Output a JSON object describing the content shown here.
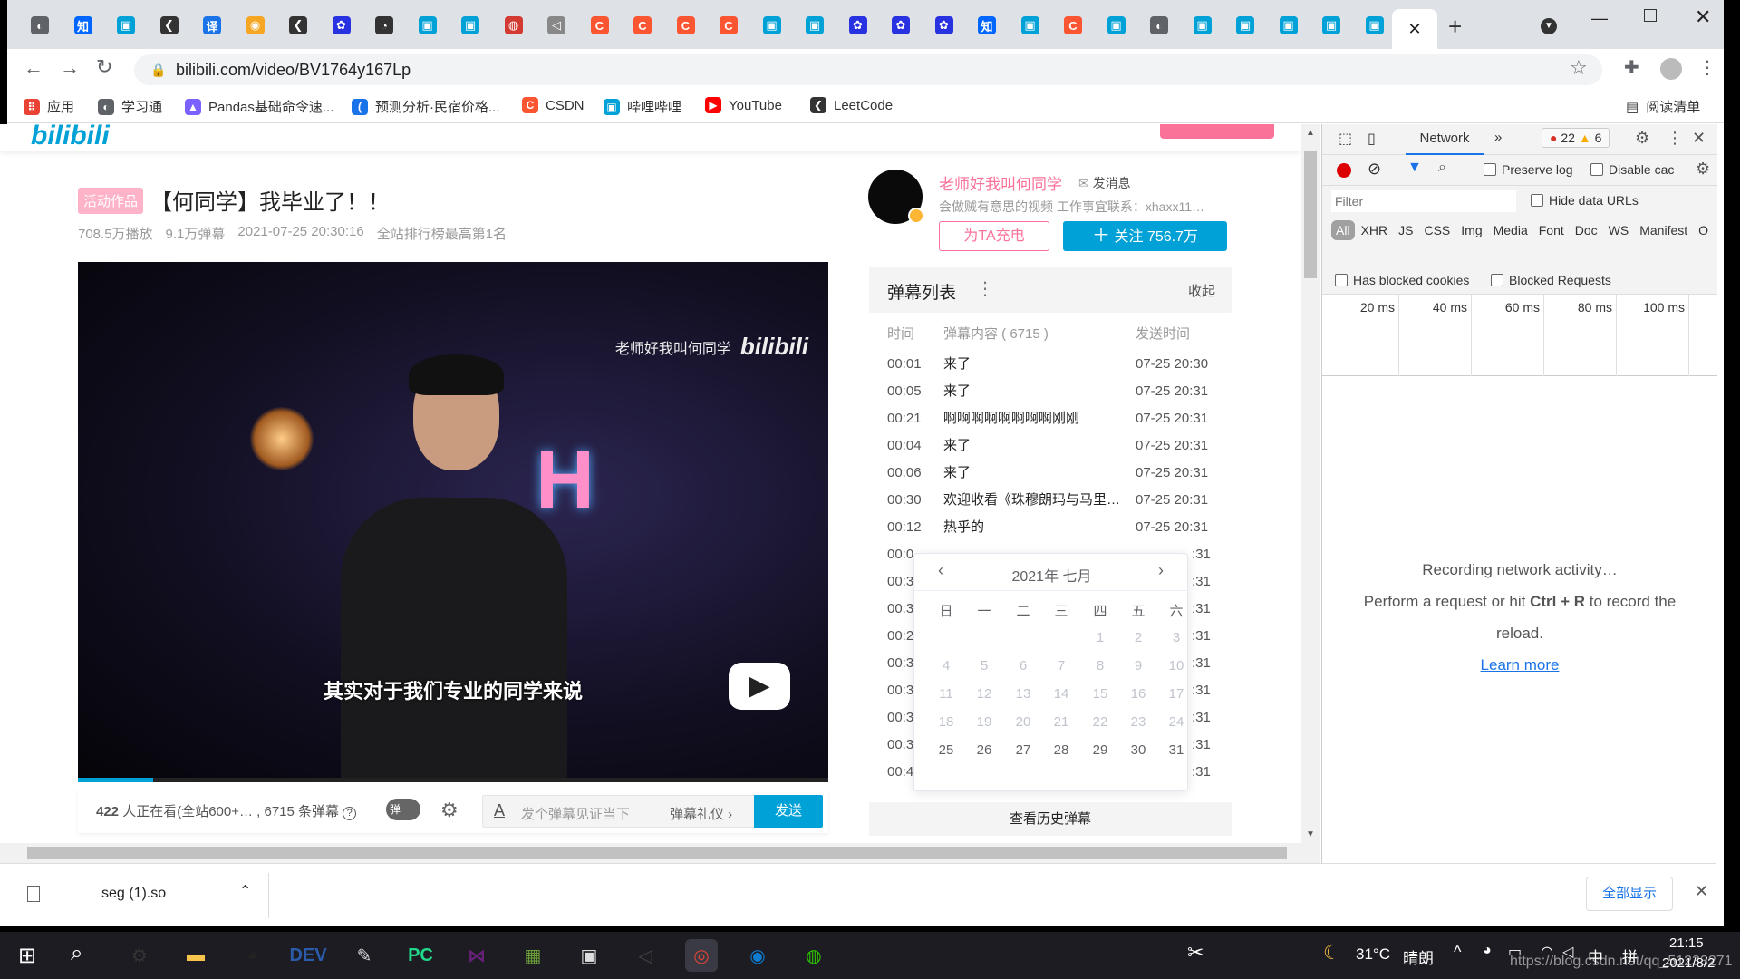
{
  "browser": {
    "tabs": [
      {
        "icon": "globe",
        "color": "#5f6368",
        "g": "◐"
      },
      {
        "icon": "zhihu",
        "color": "#0066ff",
        "g": "知"
      },
      {
        "icon": "bilibili",
        "color": "#00a1d6",
        "g": "▣"
      },
      {
        "icon": "leetcode",
        "color": "#333",
        "g": "❮"
      },
      {
        "icon": "translate",
        "color": "#1a73e8",
        "g": "译"
      },
      {
        "icon": "firefox-like",
        "color": "#f5a623",
        "g": "◉"
      },
      {
        "icon": "leetcode",
        "color": "#333",
        "g": "❮"
      },
      {
        "icon": "baidu",
        "color": "#2932e1",
        "g": "✿"
      },
      {
        "icon": "github-like",
        "color": "#333",
        "g": "◔"
      },
      {
        "icon": "bilibili",
        "color": "#00a1d6",
        "g": "▣"
      },
      {
        "icon": "bilibili",
        "color": "#00a1d6",
        "g": "▣"
      },
      {
        "icon": "netease",
        "color": "#d33a31",
        "g": "◍"
      },
      {
        "icon": "send",
        "color": "#888",
        "g": "◁"
      },
      {
        "icon": "csdn",
        "color": "#fc5531",
        "g": "C"
      },
      {
        "icon": "csdn",
        "color": "#fc5531",
        "g": "C"
      },
      {
        "icon": "csdn",
        "color": "#fc5531",
        "g": "C"
      },
      {
        "icon": "csdn",
        "color": "#fc5531",
        "g": "C"
      },
      {
        "icon": "bilibili",
        "color": "#00a1d6",
        "g": "▣"
      },
      {
        "icon": "bilibili",
        "color": "#00a1d6",
        "g": "▣"
      },
      {
        "icon": "baidu",
        "color": "#2932e1",
        "g": "✿"
      },
      {
        "icon": "baidu",
        "color": "#2932e1",
        "g": "✿"
      },
      {
        "icon": "baidu",
        "color": "#2932e1",
        "g": "✿"
      },
      {
        "icon": "zhihu",
        "color": "#0066ff",
        "g": "知"
      },
      {
        "icon": "bilibili",
        "color": "#00a1d6",
        "g": "▣"
      },
      {
        "icon": "csdn",
        "color": "#fc5531",
        "g": "C"
      },
      {
        "icon": "bilibili",
        "color": "#00a1d6",
        "g": "▣"
      },
      {
        "icon": "globe",
        "color": "#5f6368",
        "g": "◐"
      },
      {
        "icon": "bilibili",
        "color": "#00a1d6",
        "g": "▣"
      },
      {
        "icon": "bilibili",
        "color": "#00a1d6",
        "g": "▣"
      },
      {
        "icon": "bilibili",
        "color": "#00a1d6",
        "g": "▣"
      },
      {
        "icon": "bilibili",
        "color": "#00a1d6",
        "g": "▣"
      },
      {
        "icon": "bilibili",
        "color": "#00a1d6",
        "g": "▣"
      }
    ],
    "url": "bilibili.com/video/BV1764y167Lp",
    "bookmarks": [
      {
        "label": "应用",
        "color": "#ea4335",
        "g": "⠿"
      },
      {
        "label": "学习通",
        "color": "#5f6368",
        "g": "◐"
      },
      {
        "label": "Pandas基础命令速...",
        "color": "#7b61ff",
        "g": "▲"
      },
      {
        "label": "预测分析·民宿价格...",
        "color": "#1a73e8",
        "g": "("
      },
      {
        "label": "CSDN",
        "color": "#fc5531",
        "g": "C"
      },
      {
        "label": "哔哩哔哩",
        "color": "#00a1d6",
        "g": "▣"
      },
      {
        "label": "YouTube",
        "color": "#ff0000",
        "g": "▶"
      },
      {
        "label": "LeetCode",
        "color": "#333",
        "g": "❮"
      }
    ],
    "reading_list": "阅读清单"
  },
  "video": {
    "tag": "活动作品",
    "title": "【何同学】我毕业了！！",
    "views": "708.5万播放",
    "danmaku_count": "9.1万弹幕",
    "date": "2021-07-25 20:30:16",
    "rank": "全站排行榜最高第1名",
    "watermark": "老师好我叫何同学",
    "subtitle": "其实对于我们专业的同学来说",
    "progress_percent": 10,
    "viewers": "422",
    "viewers_text": "人正在看(全站600+… , 6715 条弹幕",
    "danmaku_toggle": "弹",
    "input_placeholder": "发个弹幕见证当下",
    "etiquette": "弹幕礼仪 ›",
    "send": "发送"
  },
  "uploader": {
    "name": "老师好我叫何同学",
    "message": "发消息",
    "desc": "会做贼有意思的视频 工作事宜联系：xhaxx11…",
    "charge": "为TA充电",
    "follow": "关注 756.7万"
  },
  "danmaku": {
    "title": "弹幕列表",
    "collapse": "收起",
    "headers": [
      "时间",
      "弹幕内容 ( 6715 )",
      "发送时间"
    ],
    "rows": [
      [
        "00:01",
        "来了",
        "07-25 20:30"
      ],
      [
        "00:05",
        "来了",
        "07-25 20:31"
      ],
      [
        "00:21",
        "啊啊啊啊啊啊啊啊刚刚",
        "07-25 20:31"
      ],
      [
        "00:04",
        "来了",
        "07-25 20:31"
      ],
      [
        "00:06",
        "来了",
        "07-25 20:31"
      ],
      [
        "00:30",
        "欢迎收看《珠穆朗玛与马里…",
        "07-25 20:31"
      ],
      [
        "00:12",
        "热乎的",
        "07-25 20:31"
      ]
    ],
    "hidden_rows": [
      [
        "00:0",
        ":31"
      ],
      [
        "00:3",
        ":31"
      ],
      [
        "00:3",
        ":31"
      ],
      [
        "00:2",
        ":31"
      ],
      [
        "00:3",
        ":31"
      ],
      [
        "00:3",
        ":31"
      ],
      [
        "00:3",
        ":31"
      ],
      [
        "00:3",
        ":31"
      ],
      [
        "00:4",
        ":31"
      ]
    ],
    "history": "查看历史弹幕"
  },
  "calendar": {
    "title": "2021年 七月",
    "weekdays": [
      "日",
      "一",
      "二",
      "三",
      "四",
      "五",
      "六"
    ],
    "weeks": [
      [
        "",
        "",
        "",
        "",
        "1",
        "2",
        "3"
      ],
      [
        "4",
        "5",
        "6",
        "7",
        "8",
        "9",
        "10"
      ],
      [
        "11",
        "12",
        "13",
        "14",
        "15",
        "16",
        "17"
      ],
      [
        "18",
        "19",
        "20",
        "21",
        "22",
        "23",
        "24"
      ],
      [
        "25",
        "26",
        "27",
        "28",
        "29",
        "30",
        "31"
      ]
    ],
    "enabled_from": 25
  },
  "devtools": {
    "tab": "Network",
    "errors": "22",
    "warnings": "6",
    "preserve_log": "Preserve log",
    "disable_cache": "Disable cac",
    "filter_placeholder": "Filter",
    "hide_data_urls": "Hide data URLs",
    "types": [
      "All",
      "XHR",
      "JS",
      "CSS",
      "Img",
      "Media",
      "Font",
      "Doc",
      "WS",
      "Manifest",
      "O"
    ],
    "has_blocked_cookies": "Has blocked cookies",
    "blocked_requests": "Blocked Requests",
    "timeline": [
      "20 ms",
      "40 ms",
      "60 ms",
      "80 ms",
      "100 ms"
    ],
    "recording": "Recording network activity…",
    "perform_pre": "Perform a request or hit ",
    "shortcut": "Ctrl + R",
    "perform_post": " to record the",
    "reload": "reload.",
    "learn_more": "Learn more"
  },
  "download": {
    "file": "seg (1).so",
    "show_all": "全部显示"
  },
  "taskbar": {
    "apps": [
      {
        "name": "settings",
        "color": "#333",
        "g": "⚙"
      },
      {
        "name": "explorer",
        "color": "#f8c44c",
        "g": "▬"
      },
      {
        "name": "qq",
        "color": "#222",
        "g": "◕"
      },
      {
        "name": "devcpp",
        "color": "#2a5caa",
        "g": "DEV"
      },
      {
        "name": "notepad",
        "color": "#ddd",
        "g": "✎"
      },
      {
        "name": "pycharm",
        "color": "#21d789",
        "g": "PC"
      },
      {
        "name": "visual-studio",
        "color": "#68217a",
        "g": "⋈"
      },
      {
        "name": "pictures",
        "color": "#6c9e3a",
        "g": "▦"
      },
      {
        "name": "bilibili-app",
        "color": "#ddd",
        "g": "▣"
      },
      {
        "name": "terminal",
        "color": "#444",
        "g": "◁"
      },
      {
        "name": "chrome",
        "color": "#db4437",
        "g": "◎"
      },
      {
        "name": "edge",
        "color": "#0c7bd0",
        "g": "◉"
      },
      {
        "name": "wechat",
        "color": "#2dc100",
        "g": "◍"
      }
    ],
    "weather": "31°C",
    "weather_text": "晴朗",
    "ime1": "中",
    "ime2": "拼",
    "time": "21:15",
    "date": "2021/8/2",
    "watermark": "https://blog.csdn.net/qq_51233271"
  },
  "colors": {
    "pink": "#fb7299",
    "blue": "#00a1d6",
    "dev_blue": "#1a73e8"
  }
}
